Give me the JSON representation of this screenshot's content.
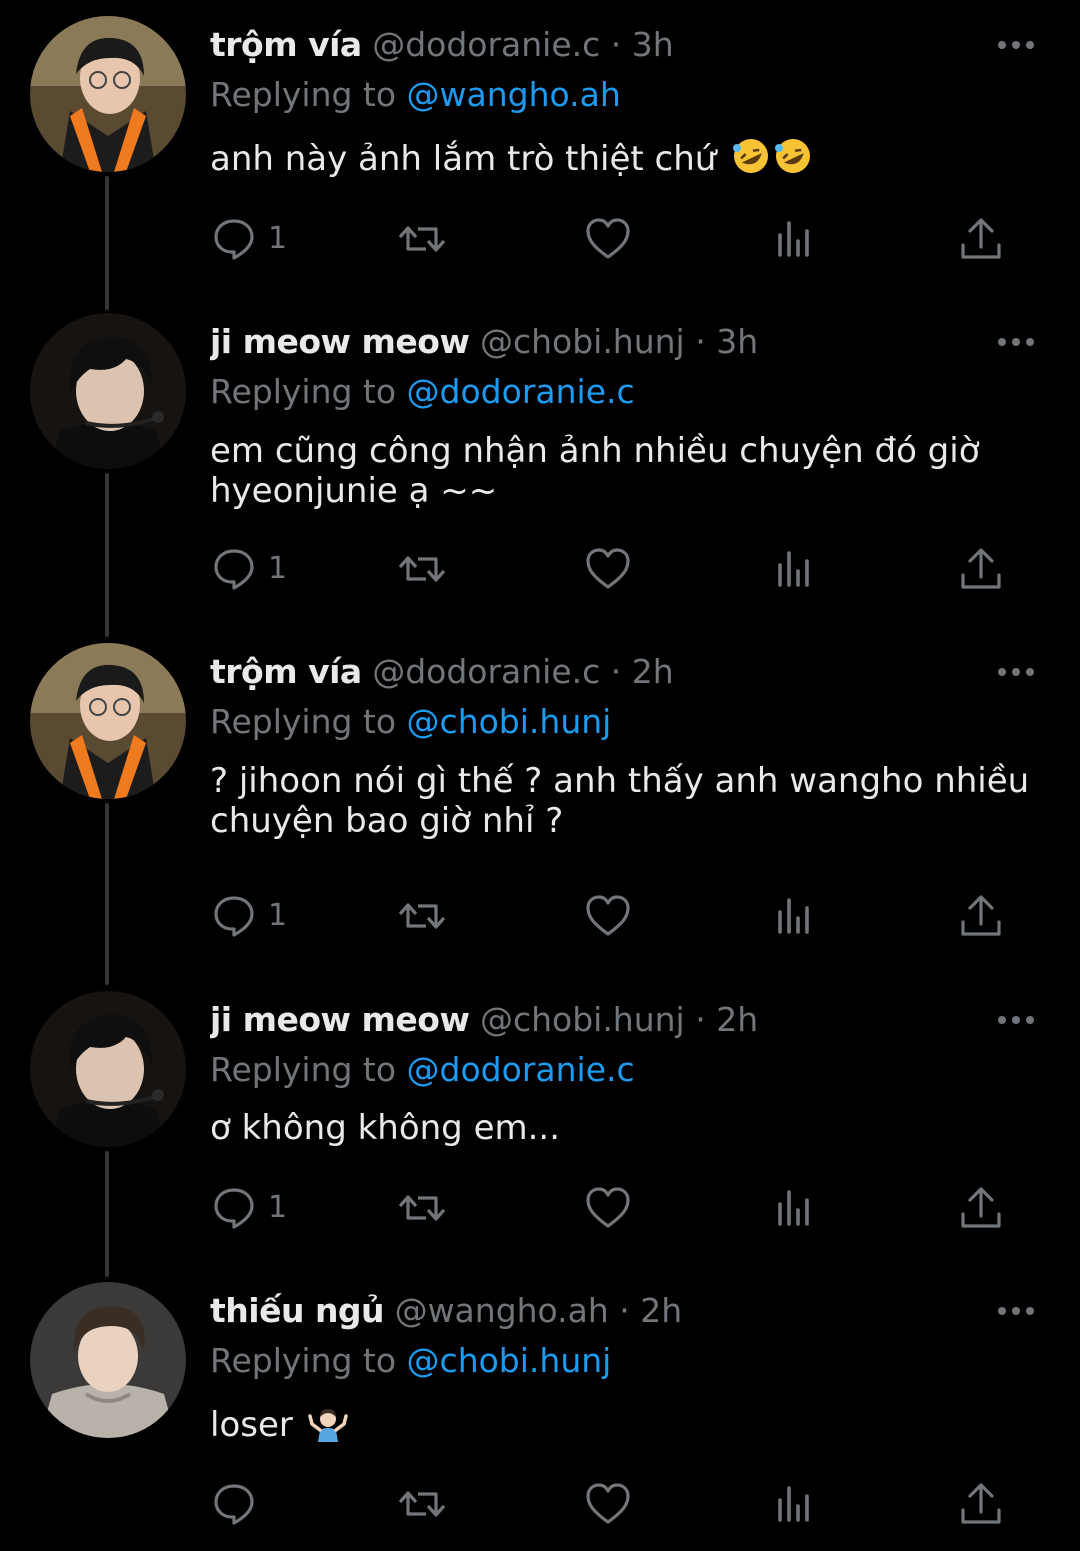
{
  "colors": {
    "background": "#000000",
    "text": "#e7e9ea",
    "muted": "#71767b",
    "link": "#1d9bf0",
    "thread_line": "#333639"
  },
  "replying_prefix": "Replying to",
  "tweets": [
    {
      "display_name": "trộm vía",
      "handle": "@dodoranie.c",
      "time": "3h",
      "reply_to": "@wangho.ah",
      "text": "anh này ảnh lắm trò thiệt chứ",
      "emoji": "rolling-on-floor-laughing x2",
      "reply_count": "1",
      "avatar": "avatar-orange-vest"
    },
    {
      "display_name": "ji meow meow",
      "handle": "@chobi.hunj",
      "time": "3h",
      "reply_to": "@dodoranie.c",
      "text": "em cũng công nhận ảnh nhiều chuyện đó giờ hyeonjunie ạ ~~",
      "emoji": "",
      "reply_count": "1",
      "avatar": "avatar-headset"
    },
    {
      "display_name": "trộm vía",
      "handle": "@dodoranie.c",
      "time": "2h",
      "reply_to": "@chobi.hunj",
      "text": "? jihoon nói gì thế ? anh thấy anh wangho nhiều chuyện bao giờ nhỉ ?",
      "emoji": "",
      "reply_count": "1",
      "avatar": "avatar-orange-vest"
    },
    {
      "display_name": "ji meow meow",
      "handle": "@chobi.hunj",
      "time": "2h",
      "reply_to": "@dodoranie.c",
      "text": "ơ không không em...",
      "emoji": "",
      "reply_count": "1",
      "avatar": "avatar-headset"
    },
    {
      "display_name": "thiếu ngủ",
      "handle": "@wangho.ah",
      "time": "2h",
      "reply_to": "@chobi.hunj",
      "text": "loser",
      "emoji": "person-shrugging",
      "reply_count": "",
      "avatar": "avatar-hoodie"
    }
  ]
}
